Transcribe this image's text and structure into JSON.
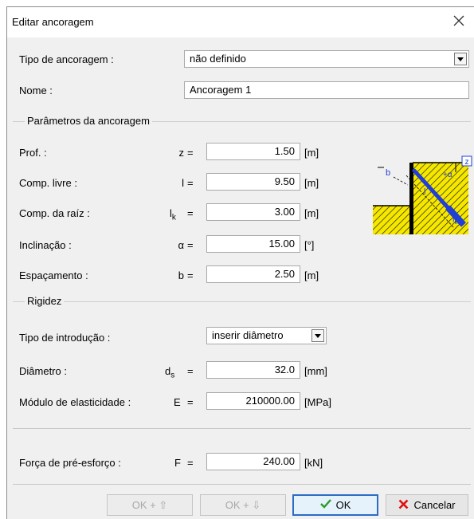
{
  "window": {
    "title": "Editar ancoragem"
  },
  "fields": {
    "tipo_label": "Tipo de ancoragem :",
    "tipo_value": "não definido",
    "nome_label": "Nome :",
    "nome_value": "Ancoragem 1"
  },
  "group_params": {
    "title": "Parâmetros da ancoragem",
    "rows": [
      {
        "label": "Prof. :",
        "sym": "z",
        "sub": "",
        "eq": "=",
        "value": "1.50",
        "unit": "[m]"
      },
      {
        "label": "Comp. livre :",
        "sym": "l",
        "sub": "",
        "eq": "=",
        "value": "9.50",
        "unit": "[m]"
      },
      {
        "label": "Comp. da raíz :",
        "sym": "l",
        "sub": "k",
        "eq": "=",
        "value": "3.00",
        "unit": "[m]"
      },
      {
        "label": "Inclinação :",
        "sym": "α",
        "sub": "",
        "eq": "=",
        "value": "15.00",
        "unit": "[°]"
      },
      {
        "label": "Espaçamento :",
        "sym": "b",
        "sub": "",
        "eq": "=",
        "value": "2.50",
        "unit": "[m]"
      }
    ]
  },
  "diagram": {
    "labels": {
      "z": "z",
      "b": "b",
      "l": "l",
      "alpha": "+α",
      "lk": "l",
      "lk_sub": "k"
    },
    "colors": {
      "soil": "#f5e700",
      "anchor": "#1f3fd6",
      "wall": "#000000"
    }
  },
  "group_rigidez": {
    "title": "Rigidez",
    "intro_label": "Tipo de introdução :",
    "intro_value": "inserir diâmetro",
    "diam_label": "Diâmetro :",
    "diam_sym": "d",
    "diam_sub": "s",
    "diam_eq": "=",
    "diam_value": "32.0",
    "diam_unit": "[mm]",
    "mod_label": "Módulo de elasticidade :",
    "mod_sym": "E",
    "mod_eq": "=",
    "mod_value": "210000.00",
    "mod_unit": "[MPa]"
  },
  "force": {
    "label": "Força de pré-esforço :",
    "sym": "F",
    "eq": "=",
    "value": "240.00",
    "unit": "[kN]"
  },
  "buttons": {
    "ok_up": "OK + ⇧",
    "ok_down": "OK + ⇩",
    "ok": "OK",
    "cancel": "Cancelar"
  }
}
